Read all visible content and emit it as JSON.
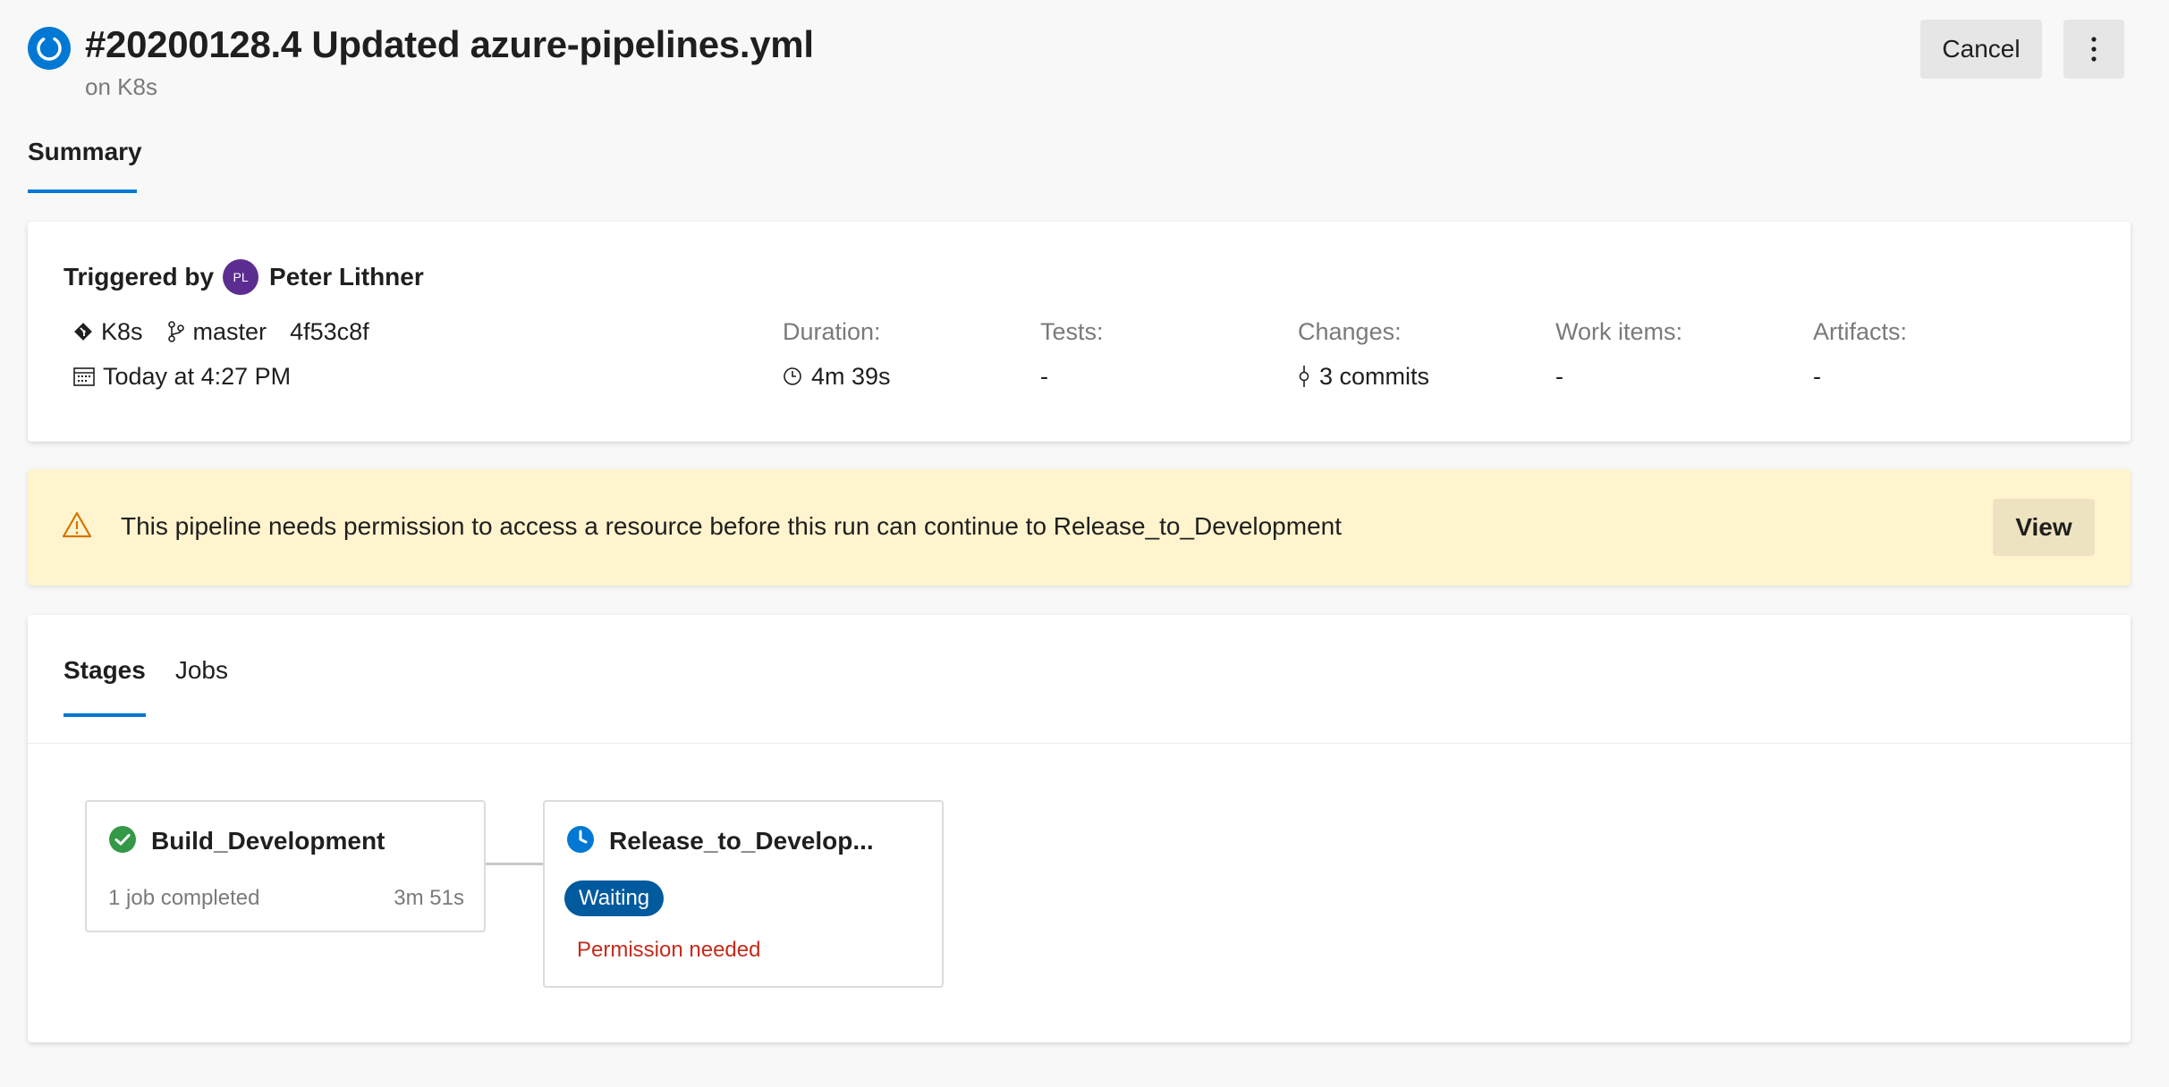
{
  "header": {
    "title": "#20200128.4 Updated azure-pipelines.yml",
    "subtitle": "on K8s",
    "cancel_label": "Cancel",
    "status_icon": "running-icon",
    "more_icon": "more-vertical-icon"
  },
  "tabs_top": {
    "summary": "Summary"
  },
  "summary": {
    "triggered_label": "Triggered by",
    "avatar_initials": "PL",
    "user_name": "Peter Lithner",
    "repo": "K8s",
    "branch": "master",
    "commit": "4f53c8f",
    "date": "Today at 4:27 PM",
    "stats": [
      {
        "label": "Duration:",
        "value": "4m 39s",
        "icon": "clock-icon"
      },
      {
        "label": "Tests:",
        "value": "-"
      },
      {
        "label": "Changes:",
        "value": "3 commits",
        "icon": "commit-icon"
      },
      {
        "label": "Work items:",
        "value": "-"
      },
      {
        "label": "Artifacts:",
        "value": "-"
      }
    ]
  },
  "banner": {
    "message": "This pipeline needs permission to access a resource before this run can continue to Release_to_Development",
    "view_label": "View",
    "icon": "warning-icon"
  },
  "stages_panel": {
    "tabs": [
      {
        "label": "Stages",
        "active": true
      },
      {
        "label": "Jobs",
        "active": false
      }
    ],
    "stages": [
      {
        "name": "Build_Development",
        "status": "succeeded",
        "detail": "1 job completed",
        "duration": "3m 51s"
      },
      {
        "name": "Release_to_Develop...",
        "status": "waiting",
        "badge": "Waiting",
        "note": "Permission needed"
      }
    ]
  },
  "colors": {
    "accent": "#0078d4",
    "success": "#107c10",
    "warning_bg": "#fff4ce",
    "error_text": "#c42b1c",
    "avatar": "#5c2d91"
  }
}
